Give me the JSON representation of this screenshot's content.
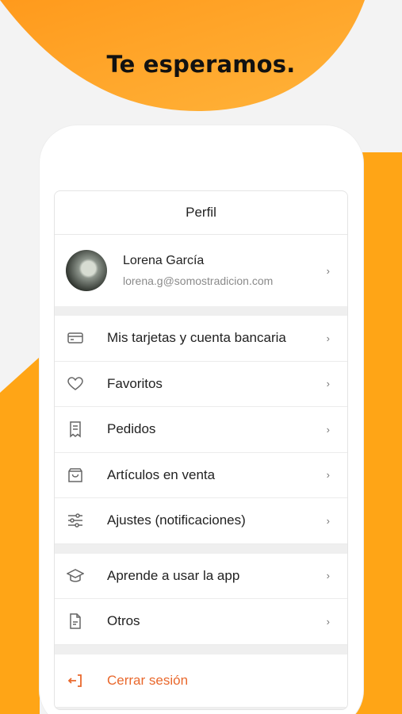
{
  "headline": "Te esperamos.",
  "panel": {
    "title": "Perfil",
    "profile": {
      "name": "Lorena García",
      "email": "lorena.g@somostradicion.com"
    },
    "group1": [
      {
        "label": "Mis tarjetas y cuenta bancaria",
        "icon": "credit-card-icon"
      },
      {
        "label": "Favoritos",
        "icon": "heart-icon"
      },
      {
        "label": "Pedidos",
        "icon": "receipt-icon"
      },
      {
        "label": "Artículos en venta",
        "icon": "shopping-bag-icon"
      },
      {
        "label": "Ajustes (notificaciones)",
        "icon": "sliders-icon"
      }
    ],
    "group2": [
      {
        "label": "Aprende a usar la app",
        "icon": "graduation-cap-icon"
      },
      {
        "label": "Otros",
        "icon": "document-icon"
      }
    ],
    "logout": {
      "label": "Cerrar sesión",
      "icon": "logout-icon"
    }
  },
  "colors": {
    "accent_orange": "#ffa516",
    "logout_red": "#e9682c",
    "background": "#f3f3f3"
  }
}
